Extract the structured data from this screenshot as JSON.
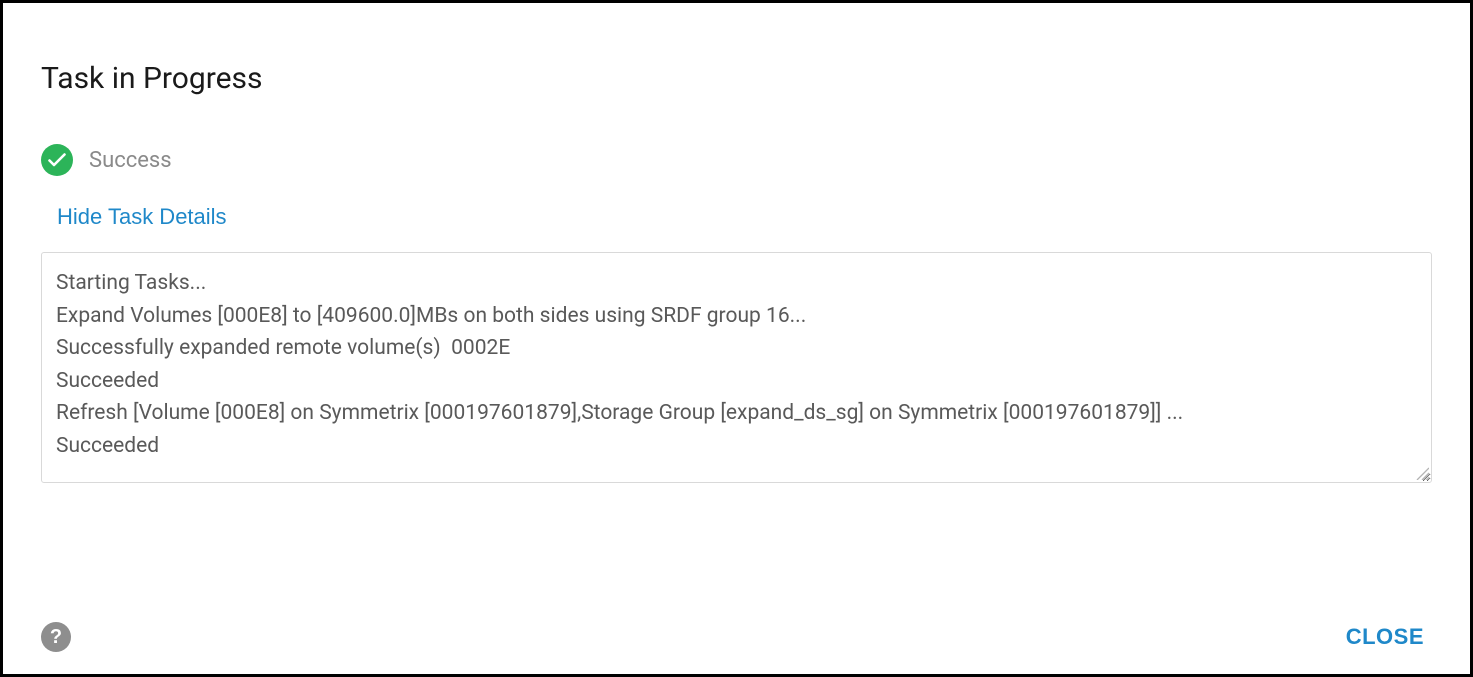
{
  "dialog": {
    "title": "Task in Progress",
    "status_label": "Success",
    "details_toggle_label": "Hide Task Details",
    "close_label": "CLOSE",
    "help_glyph": "?"
  },
  "log": {
    "lines": [
      "Starting Tasks...",
      "Expand Volumes [000E8] to [409600.0]MBs on both sides using SRDF group 16...",
      "Successfully expanded remote volume(s)  0002E",
      "Succeeded",
      "Refresh [Volume [000E8] on Symmetrix [000197601879],Storage Group [expand_ds_sg] on Symmetrix [000197601879]] ...",
      "Succeeded"
    ]
  },
  "colors": {
    "success": "#2cb459",
    "link": "#1f88c9"
  }
}
